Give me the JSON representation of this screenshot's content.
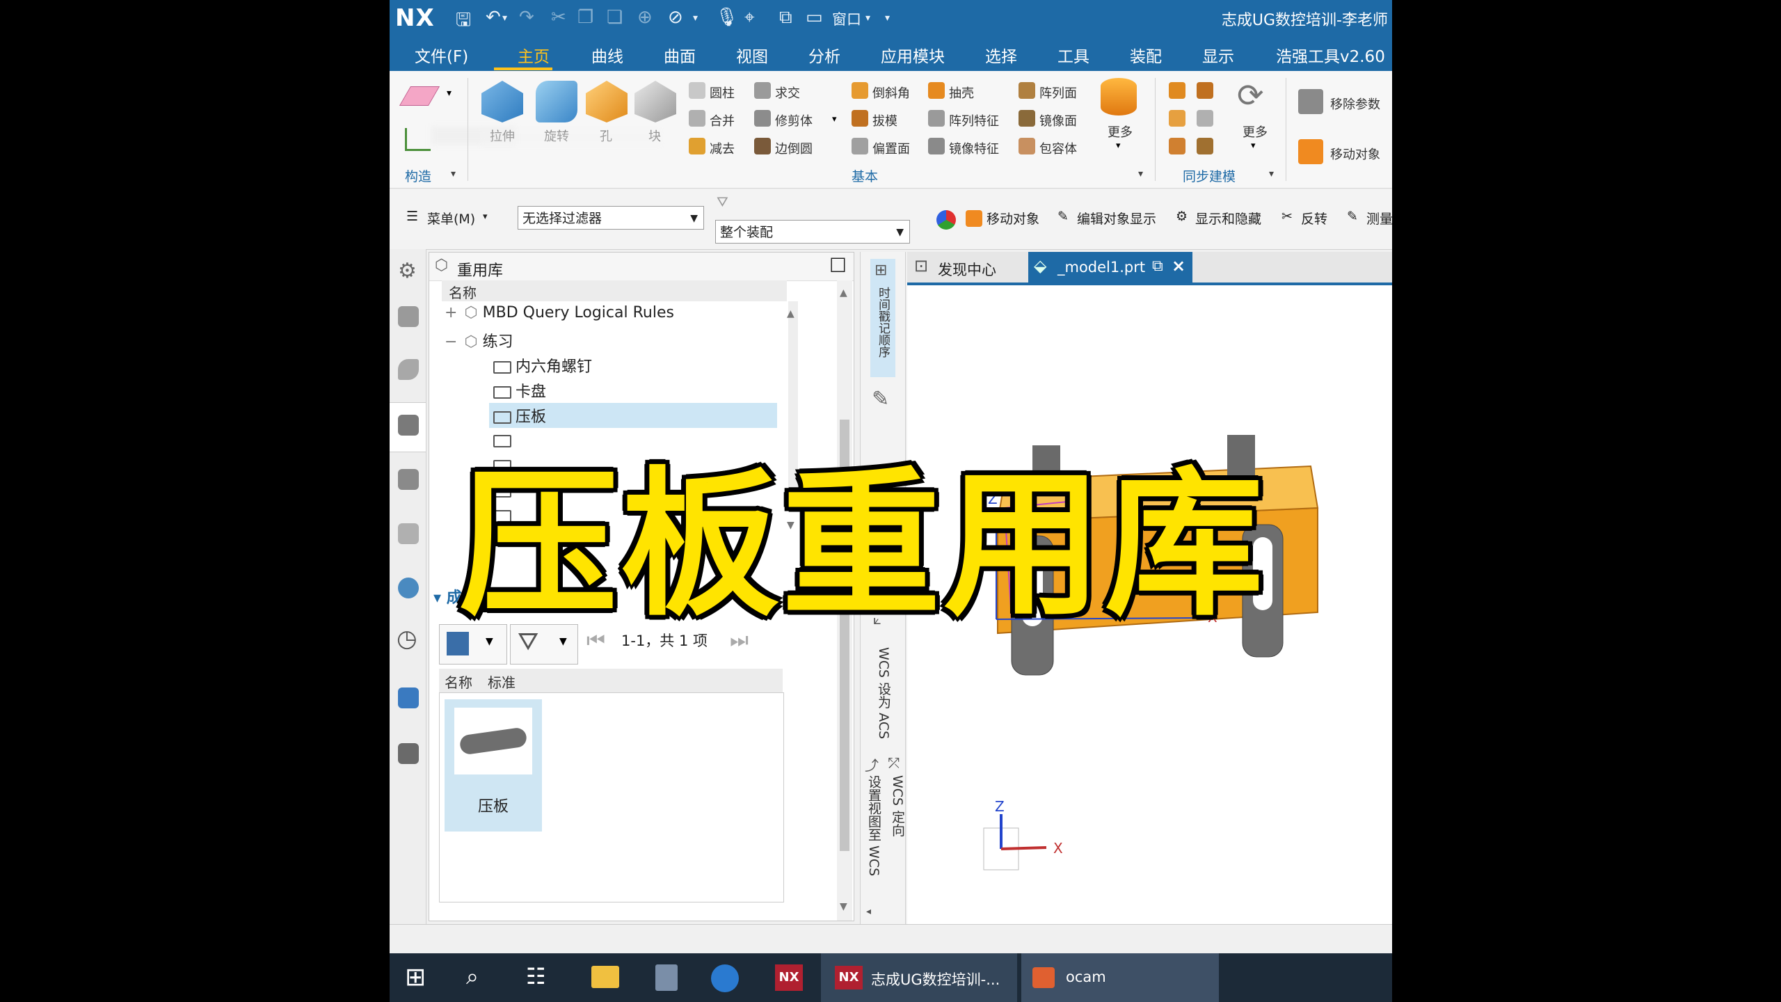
{
  "app": {
    "logo": "NX",
    "window_title": "志成UG数控培训-李老师",
    "quick_window_label": "窗口"
  },
  "menu_tabs": [
    {
      "label": "文件(F)"
    },
    {
      "label": "主页",
      "active": true
    },
    {
      "label": "曲线"
    },
    {
      "label": "曲面"
    },
    {
      "label": "视图"
    },
    {
      "label": "分析"
    },
    {
      "label": "应用模块"
    },
    {
      "label": "选择"
    },
    {
      "label": "工具"
    },
    {
      "label": "装配"
    },
    {
      "label": "显示"
    },
    {
      "label": "浩强工具v2.60"
    }
  ],
  "ribbon": {
    "construct_group": "构造",
    "basic_group": "基本",
    "sync_group": "同步建模",
    "big_tools": [
      "拉伸",
      "旋转",
      "孔",
      "块"
    ],
    "col1": [
      "圆柱",
      "合并",
      "减去"
    ],
    "col2": [
      "求交",
      "修剪体",
      "边倒圆"
    ],
    "col3": [
      "倒斜角",
      "拔模",
      "偏置面"
    ],
    "col4": [
      "抽壳",
      "阵列特征",
      "镜像特征"
    ],
    "col5": [
      "阵列面",
      "镜像面",
      "包容体"
    ],
    "more1": "更多",
    "more2": "更多",
    "remove_params": "移除参数",
    "move_object": "移动对象"
  },
  "selection_bar": {
    "menu": "菜单(M)",
    "filter": "无选择过滤器",
    "scope": "整个装配",
    "items": [
      "移动对象",
      "编辑对象显示",
      "显示和隐藏",
      "反转",
      "测量"
    ]
  },
  "reuse_library": {
    "title": "重用库",
    "column_name": "名称",
    "tree": [
      {
        "label": "MBD Query Logical Rules",
        "level": 1,
        "expander": "+"
      },
      {
        "label": "练习",
        "level": 1,
        "expander": "−"
      },
      {
        "label": "内六角螺钉",
        "level": 2
      },
      {
        "label": "卡盘",
        "level": 2
      },
      {
        "label": "压板",
        "level": 2,
        "selected": true
      }
    ],
    "member_section": "成员选择 - 压板",
    "pager": "1-1，共 1 项",
    "member_columns": [
      "名称",
      "标准"
    ],
    "members": [
      {
        "label": "压板"
      }
    ]
  },
  "resource_bar": {
    "history_tab": "时间戳记顺序",
    "wcs_items": [
      "WCS",
      "WCS 设为 ACS",
      "WCS 定向",
      "设置视图至 WCS"
    ]
  },
  "graphics": {
    "tabs": [
      {
        "label": "发现中心"
      },
      {
        "label": "_model1.prt",
        "active": true
      }
    ],
    "axis_x": "X",
    "axis_z": "Z"
  },
  "taskbar": {
    "app1": "志成UG数控培训-...",
    "app2": "ocam"
  },
  "overlay_caption": "压板重用库",
  "colors": {
    "titlebar": "#1e6aa6",
    "active_tab": "#ffc21a",
    "part_orange": "#f0a020",
    "overlay": "#ffe400"
  }
}
